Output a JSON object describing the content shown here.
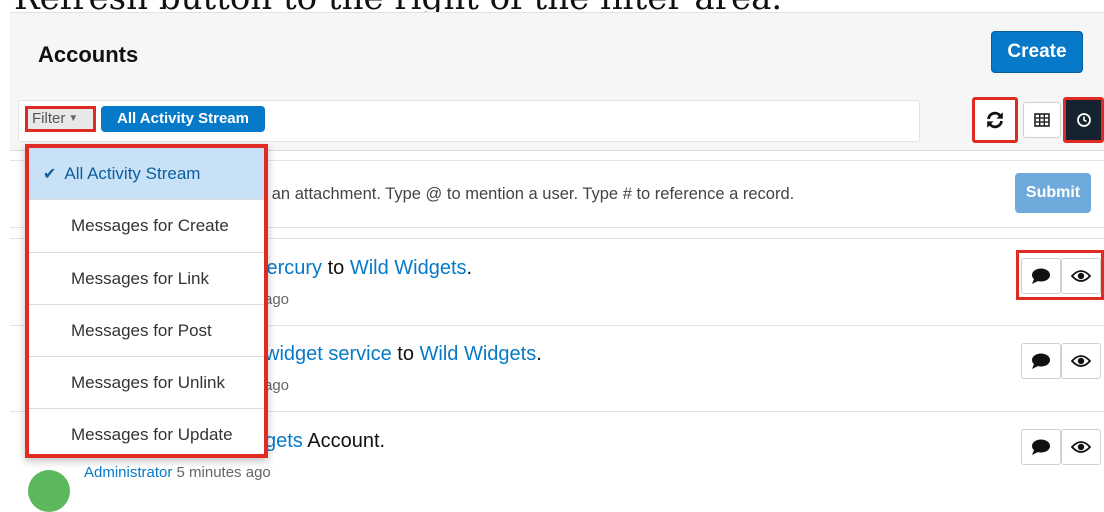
{
  "caption": "Refresh button to the right of the filter area.",
  "header": {
    "title": "Accounts",
    "create_label": "Create"
  },
  "filter": {
    "dropdown_label": "Filter",
    "active_filter": "All Activity Stream",
    "options": [
      {
        "label": "All Activity Stream",
        "selected": true
      },
      {
        "label": "Messages for Create",
        "selected": false
      },
      {
        "label": "Messages for Link",
        "selected": false
      },
      {
        "label": "Messages for Post",
        "selected": false
      },
      {
        "label": "Messages for Unlink",
        "selected": false
      },
      {
        "label": "Messages for Update",
        "selected": false
      }
    ]
  },
  "toolbar": {
    "refresh_icon": "refresh-icon",
    "list_view_icon": "table-icon",
    "activity_view_icon": "clock-icon"
  },
  "composer": {
    "placeholder_visible": "p an attachment. Type @ to mention a user. Type # to reference a record.",
    "submit_label": "Submit"
  },
  "activities": [
    {
      "pre": "lercury",
      "mid": " to ",
      "target": "Wild Widgets",
      "post": ".",
      "time": "ago"
    },
    {
      "pre": "widget service",
      "mid": " to ",
      "target": "Wild Widgets",
      "post": ".",
      "time": "ago"
    },
    {
      "pre": "gets",
      "mid": " Account.",
      "time_user": "Administrator",
      "time_rest": " 5 minutes ago"
    }
  ],
  "colors": {
    "accent": "#0679c8",
    "highlight": "#e02b24",
    "selected_bg": "#c8e1f6",
    "submit_disabled": "#70a9dc"
  }
}
